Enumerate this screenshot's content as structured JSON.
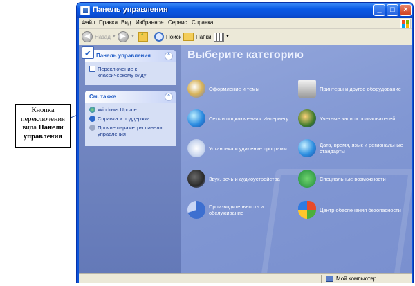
{
  "window": {
    "title": "Панель управления"
  },
  "menubar": {
    "items": [
      "Файл",
      "Правка",
      "Вид",
      "Избранное",
      "Сервис",
      "Справка"
    ]
  },
  "toolbar": {
    "back_label": "Назад",
    "search_label": "Поиск",
    "folders_label": "Папки"
  },
  "sidebar": {
    "control_panel": {
      "title": "Панель управления",
      "switch_link": "Переключение к классическому виду"
    },
    "see_also": {
      "title": "См. также",
      "links": [
        "Windows Update",
        "Справка и поддержка",
        "Прочие параметры панели управления"
      ]
    }
  },
  "main": {
    "heading": "Выберите категорию",
    "categories": [
      "Оформление и темы",
      "Принтеры и другое оборудование",
      "Сеть и подключения к Интернету",
      "Учетные записи пользователей",
      "Установка и удаление программ",
      "Дата, время, язык и региональные стандарты",
      "Звук, речь и аудиоустройства",
      "Специальные возможности",
      "Производительность и обслуживание",
      "Центр обеспечения безопасности"
    ]
  },
  "statusbar": {
    "text": "Мой компьютер"
  },
  "callout": {
    "line1": "Кнопка переключения вида",
    "bold": "Панели управления"
  },
  "colors": {
    "titlebar": "#0a5ae6",
    "sidebar": "#7a8ec6",
    "main": "#8197d3",
    "link": "#1c3b8c"
  }
}
